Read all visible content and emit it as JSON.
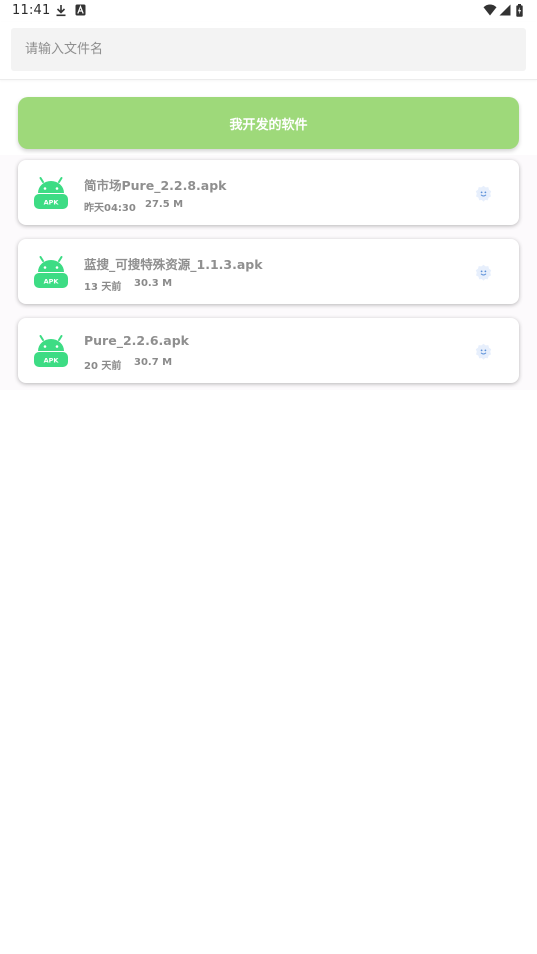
{
  "status_bar": {
    "time": "11:41",
    "icons": [
      "download-icon",
      "font-a-icon",
      "wifi-icon",
      "signal-icon",
      "battery-icon"
    ]
  },
  "search": {
    "placeholder": "请输入文件名",
    "value": ""
  },
  "dev_button": {
    "label": "我开发的软件",
    "color": "#9ed97a"
  },
  "files": [
    {
      "name": "简市场Pure_2.2.8.apk",
      "time": "昨天04:30",
      "size": "27.5 M",
      "icon": "apk-android-icon",
      "action_icon": "smile-icon"
    },
    {
      "name": "蓝搜_可搜特殊资源_1.1.3.apk",
      "time": "13 天前",
      "size": "30.3 M",
      "icon": "apk-android-icon",
      "action_icon": "smile-icon"
    },
    {
      "name": "Pure_2.2.6.apk",
      "time": "20 天前",
      "size": "30.7 M",
      "icon": "apk-android-icon",
      "action_icon": "smile-icon"
    }
  ],
  "colors": {
    "apk_green": "#3ddc84",
    "apk_text": "#ffffff",
    "smile_bg": "#e7effc",
    "smile_face": "#5a8fd8"
  }
}
